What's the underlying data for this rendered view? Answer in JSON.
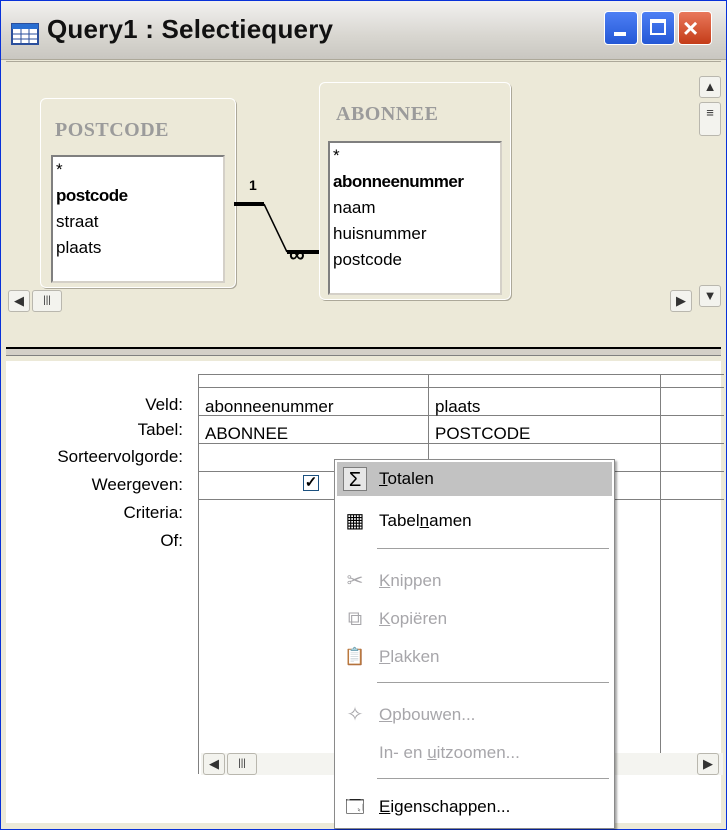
{
  "window": {
    "title": "Query1 : Selectiequery",
    "close_glyph": "×"
  },
  "tables": [
    {
      "name": "POSTCODE",
      "fields": [
        "*",
        "postcode",
        "straat",
        "plaats"
      ],
      "key_field": "postcode"
    },
    {
      "name": "ABONNEE",
      "fields": [
        "*",
        "abonneenummer",
        "naam",
        "huisnummer",
        "postcode"
      ],
      "key_field": "abonneenummer"
    }
  ],
  "relationship": {
    "one_label": "1",
    "many_label": "∞"
  },
  "grid": {
    "row_labels": [
      "Veld:",
      "Tabel:",
      "Sorteervolgorde:",
      "Weergeven:",
      "Criteria:",
      "Of:"
    ],
    "columns": [
      {
        "veld": "abonneenummer",
        "tabel": "ABONNEE",
        "weergeven": true
      },
      {
        "veld": "plaats",
        "tabel": "POSTCODE",
        "weergeven": true
      }
    ],
    "checkmark": "✓"
  },
  "context_menu": {
    "items": [
      {
        "label_pre": "",
        "label_u": "T",
        "label_post": "otalen",
        "icon": "sigma-icon",
        "glyph": "Σ",
        "enabled": true,
        "selected": true
      },
      {
        "label_pre": "Tabel",
        "label_u": "n",
        "label_post": "amen",
        "icon": "table-names-icon",
        "glyph": "▦",
        "enabled": true,
        "selected": false
      },
      {
        "label_pre": "",
        "label_u": "K",
        "label_post": "nippen",
        "icon": "scissors-icon",
        "glyph": "✂",
        "enabled": false
      },
      {
        "label_pre": "",
        "label_u": "K",
        "label_post": "opiëren",
        "icon": "copy-icon",
        "glyph": "⧉",
        "enabled": false
      },
      {
        "label_pre": "",
        "label_u": "P",
        "label_post": "lakken",
        "icon": "paste-icon",
        "glyph": "📋",
        "enabled": false
      },
      {
        "label_pre": "",
        "label_u": "O",
        "label_post": "pbouwen...",
        "icon": "build-wand-icon",
        "glyph": "✧",
        "enabled": false
      },
      {
        "label_pre": "In- en ",
        "label_u": "u",
        "label_post": "itzoomen...",
        "icon": "",
        "glyph": "",
        "enabled": false
      },
      {
        "label_pre": "",
        "label_u": "E",
        "label_post": "igenschappen...",
        "icon": "properties-icon",
        "glyph": "🗔",
        "enabled": true
      }
    ]
  },
  "scroll": {
    "up": "▲",
    "down": "▼",
    "left": "◀",
    "right": "▶",
    "thumb": "|||"
  }
}
